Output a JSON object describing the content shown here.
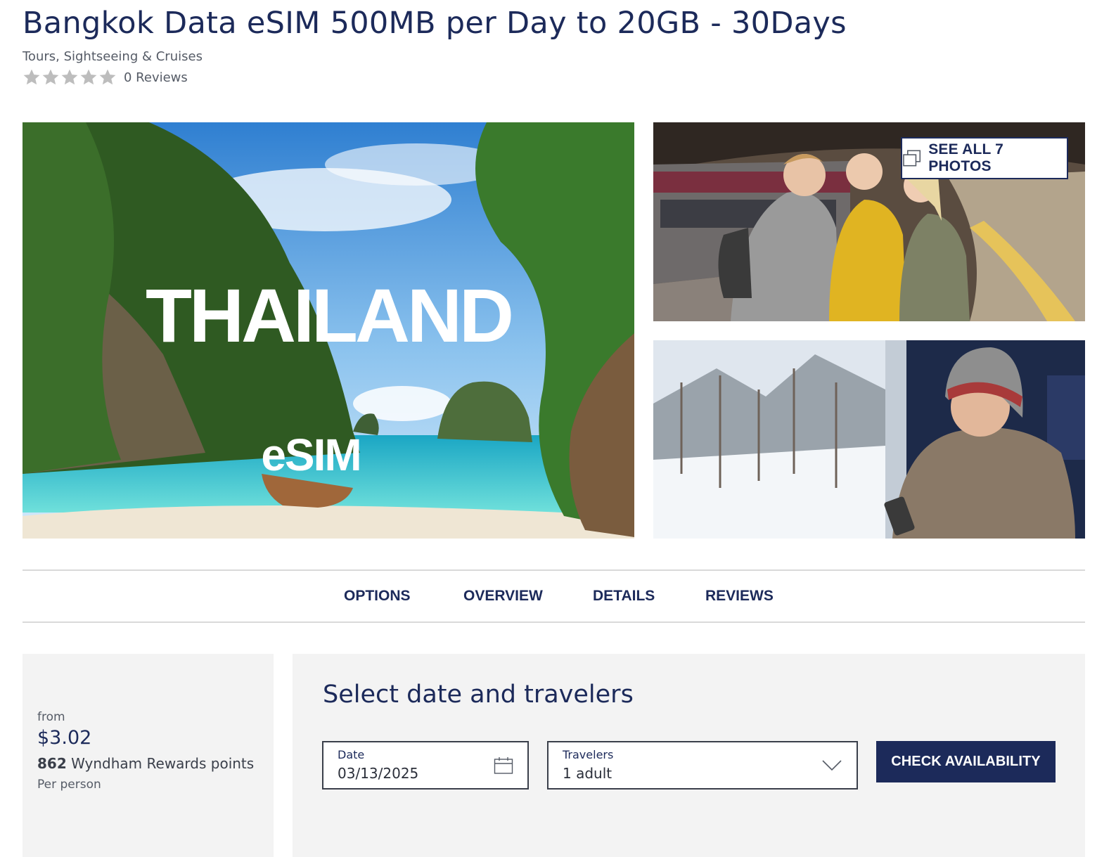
{
  "product": {
    "title": "Bangkok Data eSIM 500MB per Day to 20GB - 30Days",
    "category": "Tours, Sightseeing & Cruises",
    "rating": {
      "stars": 0,
      "max_stars": 5,
      "reviews_label": "0 Reviews"
    }
  },
  "gallery": {
    "main_image": {
      "overlay_title": "THAILAND",
      "overlay_subtitle": "eSIM"
    },
    "see_all_label": "SEE ALL 7 PHOTOS"
  },
  "tabs": [
    {
      "label": "OPTIONS"
    },
    {
      "label": "OVERVIEW"
    },
    {
      "label": "DETAILS"
    },
    {
      "label": "REVIEWS"
    }
  ],
  "pricing": {
    "from_label": "from",
    "price": "$3.02",
    "points_value": "862",
    "points_label": "Wyndham Rewards points",
    "per_person_label": "Per person"
  },
  "booking": {
    "title": "Select date and travelers",
    "date": {
      "label": "Date",
      "value": "03/13/2025"
    },
    "travelers": {
      "label": "Travelers",
      "value": "1 adult"
    },
    "check_button_label": "CHECK AVAILABILITY"
  },
  "colors": {
    "brand_navy": "#1c2a5a",
    "panel_bg": "#f3f3f3",
    "star_empty": "#bdbdbd"
  },
  "icons": {
    "rating": "star-icon",
    "gallery": "photos-icon",
    "date": "calendar-icon",
    "travelers": "chevron-down-icon"
  }
}
